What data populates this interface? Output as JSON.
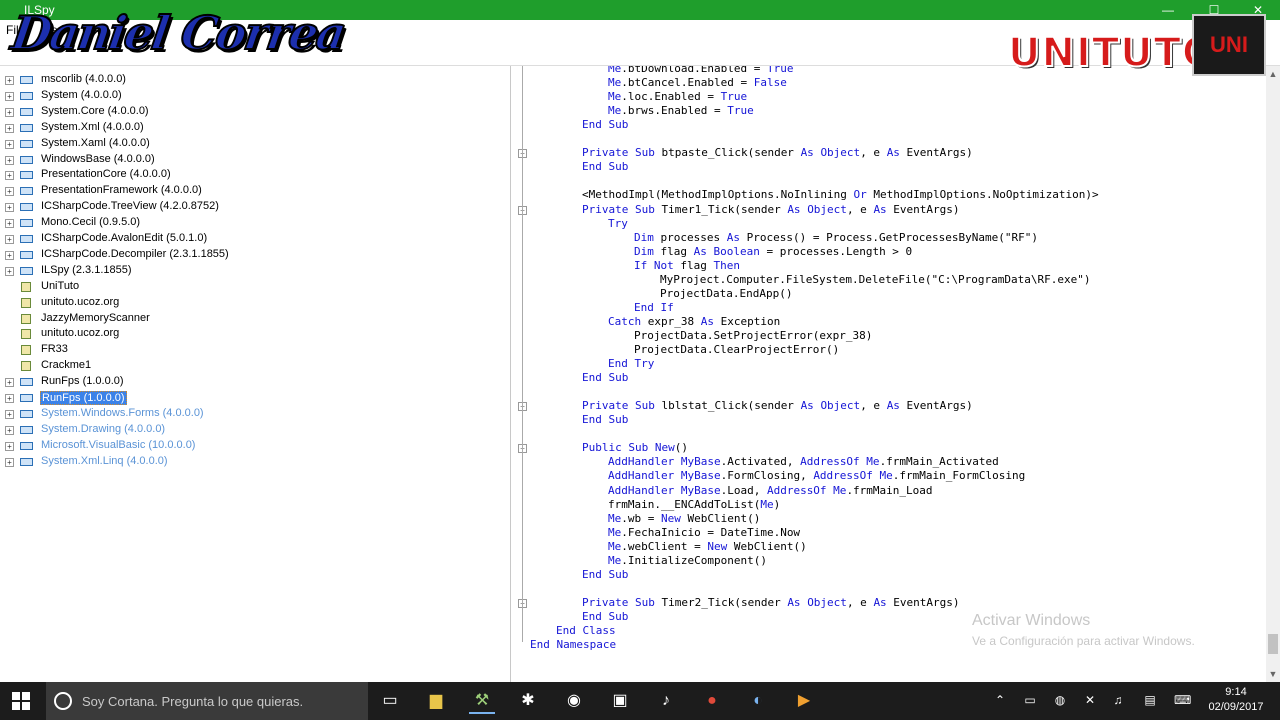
{
  "window": {
    "title": "ILSpy",
    "btn_min": "—",
    "btn_max": "☐",
    "btn_close": "✕"
  },
  "menu": {
    "file": "File",
    "view": "View",
    "help": "Help"
  },
  "overlays": {
    "left_logo": "Daniel Correa",
    "right_logo": "UNITUTO",
    "right_badge": "UNI"
  },
  "tree": {
    "items": [
      {
        "label": "mscorlib (4.0.0.0)",
        "state": "normal",
        "icon": "assembly"
      },
      {
        "label": "System (4.0.0.0)",
        "state": "normal",
        "icon": "assembly"
      },
      {
        "label": "System.Core (4.0.0.0)",
        "state": "normal",
        "icon": "assembly"
      },
      {
        "label": "System.Xml (4.0.0.0)",
        "state": "normal",
        "icon": "assembly"
      },
      {
        "label": "System.Xaml (4.0.0.0)",
        "state": "normal",
        "icon": "assembly"
      },
      {
        "label": "WindowsBase (4.0.0.0)",
        "state": "normal",
        "icon": "assembly"
      },
      {
        "label": "PresentationCore (4.0.0.0)",
        "state": "normal",
        "icon": "assembly"
      },
      {
        "label": "PresentationFramework (4.0.0.0)",
        "state": "normal",
        "icon": "assembly"
      },
      {
        "label": "ICSharpCode.TreeView (4.2.0.8752)",
        "state": "normal",
        "icon": "assembly"
      },
      {
        "label": "Mono.Cecil (0.9.5.0)",
        "state": "normal",
        "icon": "assembly"
      },
      {
        "label": "ICSharpCode.AvalonEdit (5.0.1.0)",
        "state": "normal",
        "icon": "assembly"
      },
      {
        "label": "ICSharpCode.Decompiler (2.3.1.1855)",
        "state": "normal",
        "icon": "assembly"
      },
      {
        "label": "ILSpy (2.3.1.1855)",
        "state": "normal",
        "icon": "assembly"
      },
      {
        "label": "UniTuto",
        "state": "normal",
        "icon": "resource"
      },
      {
        "label": "unituto.ucoz.org",
        "state": "normal",
        "icon": "resource"
      },
      {
        "label": "JazzyMemoryScanner",
        "state": "normal",
        "icon": "resource"
      },
      {
        "label": "unituto.ucoz.org",
        "state": "normal",
        "icon": "resource"
      },
      {
        "label": "FR33",
        "state": "normal",
        "icon": "resource"
      },
      {
        "label": "Crackme1",
        "state": "normal",
        "icon": "resource"
      },
      {
        "label": "RunFps (1.0.0.0)",
        "state": "normal",
        "icon": "assembly"
      },
      {
        "label": "RunFps (1.0.0.0)",
        "state": "selected",
        "icon": "assembly"
      },
      {
        "label": "System.Windows.Forms (4.0.0.0)",
        "state": "dim",
        "icon": "assembly"
      },
      {
        "label": "System.Drawing (4.0.0.0)",
        "state": "dim",
        "icon": "assembly"
      },
      {
        "label": "Microsoft.VisualBasic (10.0.0.0)",
        "state": "dim",
        "icon": "assembly"
      },
      {
        "label": "System.Xml.Linq (4.0.0.0)",
        "state": "dim",
        "icon": "assembly"
      }
    ]
  },
  "code": {
    "lines": [
      {
        "indent": 6,
        "fold": false,
        "tokens": [
          [
            "Me",
            "kw"
          ],
          [
            ".btDownload.Enabled = ",
            ""
          ],
          [
            "True",
            "kw"
          ]
        ]
      },
      {
        "indent": 6,
        "fold": false,
        "tokens": [
          [
            "Me",
            "kw"
          ],
          [
            ".btCancel.Enabled = ",
            ""
          ],
          [
            "False",
            "kw"
          ]
        ]
      },
      {
        "indent": 6,
        "fold": false,
        "tokens": [
          [
            "Me",
            "kw"
          ],
          [
            ".loc.Enabled = ",
            ""
          ],
          [
            "True",
            "kw"
          ]
        ]
      },
      {
        "indent": 6,
        "fold": false,
        "tokens": [
          [
            "Me",
            "kw"
          ],
          [
            ".brws.Enabled = ",
            ""
          ],
          [
            "True",
            "kw"
          ]
        ]
      },
      {
        "indent": 4,
        "fold": false,
        "tokens": [
          [
            "End Sub",
            "kw"
          ]
        ]
      },
      {
        "indent": 0,
        "fold": false,
        "tokens": []
      },
      {
        "indent": 4,
        "fold": true,
        "tokens": [
          [
            "Private Sub",
            "kw"
          ],
          [
            " btpaste_Click(sender ",
            ""
          ],
          [
            "As",
            "kw"
          ],
          [
            " ",
            ""
          ],
          [
            "Object",
            "kw"
          ],
          [
            ", e ",
            ""
          ],
          [
            "As",
            "kw"
          ],
          [
            " EventArgs)",
            ""
          ]
        ]
      },
      {
        "indent": 4,
        "fold": false,
        "tokens": [
          [
            "End Sub",
            "kw"
          ]
        ]
      },
      {
        "indent": 0,
        "fold": false,
        "tokens": []
      },
      {
        "indent": 4,
        "fold": false,
        "tokens": [
          [
            "<MethodImpl(MethodImplOptions.NoInlining ",
            ""
          ],
          [
            "Or",
            "kw"
          ],
          [
            " MethodImplOptions.NoOptimization)>",
            ""
          ]
        ]
      },
      {
        "indent": 4,
        "fold": true,
        "tokens": [
          [
            "Private Sub",
            "kw"
          ],
          [
            " Timer1_Tick(sender ",
            ""
          ],
          [
            "As",
            "kw"
          ],
          [
            " ",
            ""
          ],
          [
            "Object",
            "kw"
          ],
          [
            ", e ",
            ""
          ],
          [
            "As",
            "kw"
          ],
          [
            " EventArgs)",
            ""
          ]
        ]
      },
      {
        "indent": 6,
        "fold": false,
        "tokens": [
          [
            "Try",
            "kw"
          ]
        ]
      },
      {
        "indent": 8,
        "fold": false,
        "tokens": [
          [
            "Dim",
            "kw"
          ],
          [
            " processes ",
            ""
          ],
          [
            "As",
            "kw"
          ],
          [
            " Process() = Process.GetProcessesByName(\"RF\")",
            ""
          ]
        ]
      },
      {
        "indent": 8,
        "fold": false,
        "tokens": [
          [
            "Dim",
            "kw"
          ],
          [
            " flag ",
            ""
          ],
          [
            "As",
            "kw"
          ],
          [
            " ",
            ""
          ],
          [
            "Boolean",
            "kw"
          ],
          [
            " = processes.Length > 0",
            ""
          ]
        ]
      },
      {
        "indent": 8,
        "fold": false,
        "tokens": [
          [
            "If Not",
            "kw"
          ],
          [
            " flag ",
            ""
          ],
          [
            "Then",
            "kw"
          ]
        ]
      },
      {
        "indent": 10,
        "fold": false,
        "tokens": [
          [
            "MyProject.Computer.FileSystem.DeleteFile(\"C:\\ProgramData\\RF.exe\")",
            ""
          ]
        ]
      },
      {
        "indent": 10,
        "fold": false,
        "tokens": [
          [
            "ProjectData.EndApp()",
            ""
          ]
        ]
      },
      {
        "indent": 8,
        "fold": false,
        "tokens": [
          [
            "End If",
            "kw"
          ]
        ]
      },
      {
        "indent": 6,
        "fold": false,
        "tokens": [
          [
            "Catch",
            "kw"
          ],
          [
            " expr_38 ",
            ""
          ],
          [
            "As",
            "kw"
          ],
          [
            " Exception",
            ""
          ]
        ]
      },
      {
        "indent": 8,
        "fold": false,
        "tokens": [
          [
            "ProjectData.SetProjectError(expr_38)",
            ""
          ]
        ]
      },
      {
        "indent": 8,
        "fold": false,
        "tokens": [
          [
            "ProjectData.ClearProjectError()",
            ""
          ]
        ]
      },
      {
        "indent": 6,
        "fold": false,
        "tokens": [
          [
            "End Try",
            "kw"
          ]
        ]
      },
      {
        "indent": 4,
        "fold": false,
        "tokens": [
          [
            "End Sub",
            "kw"
          ]
        ]
      },
      {
        "indent": 0,
        "fold": false,
        "tokens": []
      },
      {
        "indent": 4,
        "fold": true,
        "tokens": [
          [
            "Private Sub",
            "kw"
          ],
          [
            " lblstat_Click(sender ",
            ""
          ],
          [
            "As",
            "kw"
          ],
          [
            " ",
            ""
          ],
          [
            "Object",
            "kw"
          ],
          [
            ", e ",
            ""
          ],
          [
            "As",
            "kw"
          ],
          [
            " EventArgs)",
            ""
          ]
        ]
      },
      {
        "indent": 4,
        "fold": false,
        "tokens": [
          [
            "End Sub",
            "kw"
          ]
        ]
      },
      {
        "indent": 0,
        "fold": false,
        "tokens": []
      },
      {
        "indent": 4,
        "fold": true,
        "tokens": [
          [
            "Public Sub New",
            "kw"
          ],
          [
            "()",
            ""
          ]
        ]
      },
      {
        "indent": 6,
        "fold": false,
        "tokens": [
          [
            "AddHandler MyBase",
            "kw"
          ],
          [
            ".Activated, ",
            ""
          ],
          [
            "AddressOf Me",
            "kw"
          ],
          [
            ".frmMain_Activated",
            ""
          ]
        ]
      },
      {
        "indent": 6,
        "fold": false,
        "tokens": [
          [
            "AddHandler MyBase",
            "kw"
          ],
          [
            ".FormClosing, ",
            ""
          ],
          [
            "AddressOf Me",
            "kw"
          ],
          [
            ".frmMain_FormClosing",
            ""
          ]
        ]
      },
      {
        "indent": 6,
        "fold": false,
        "tokens": [
          [
            "AddHandler MyBase",
            "kw"
          ],
          [
            ".Load, ",
            ""
          ],
          [
            "AddressOf Me",
            "kw"
          ],
          [
            ".frmMain_Load",
            ""
          ]
        ]
      },
      {
        "indent": 6,
        "fold": false,
        "tokens": [
          [
            "frmMain.__ENCAddToList(",
            ""
          ],
          [
            "Me",
            "kw"
          ],
          [
            ")",
            ""
          ]
        ]
      },
      {
        "indent": 6,
        "fold": false,
        "tokens": [
          [
            "Me",
            "kw"
          ],
          [
            ".wb = ",
            ""
          ],
          [
            "New",
            "kw"
          ],
          [
            " WebClient()",
            ""
          ]
        ]
      },
      {
        "indent": 6,
        "fold": false,
        "tokens": [
          [
            "Me",
            "kw"
          ],
          [
            ".FechaInicio = DateTime.Now",
            ""
          ]
        ]
      },
      {
        "indent": 6,
        "fold": false,
        "tokens": [
          [
            "Me",
            "kw"
          ],
          [
            ".webClient = ",
            ""
          ],
          [
            "New",
            "kw"
          ],
          [
            " WebClient()",
            ""
          ]
        ]
      },
      {
        "indent": 6,
        "fold": false,
        "tokens": [
          [
            "Me",
            "kw"
          ],
          [
            ".InitializeComponent()",
            ""
          ]
        ]
      },
      {
        "indent": 4,
        "fold": false,
        "tokens": [
          [
            "End Sub",
            "kw"
          ]
        ]
      },
      {
        "indent": 0,
        "fold": false,
        "tokens": []
      },
      {
        "indent": 4,
        "fold": true,
        "tokens": [
          [
            "Private Sub",
            "kw"
          ],
          [
            " Timer2_Tick(sender ",
            ""
          ],
          [
            "As",
            "kw"
          ],
          [
            " ",
            ""
          ],
          [
            "Object",
            "kw"
          ],
          [
            ", e ",
            ""
          ],
          [
            "As",
            "kw"
          ],
          [
            " EventArgs)",
            ""
          ]
        ]
      },
      {
        "indent": 4,
        "fold": false,
        "tokens": [
          [
            "End Sub",
            "kw"
          ]
        ]
      },
      {
        "indent": 2,
        "fold": false,
        "tokens": [
          [
            "End Class",
            "kw"
          ]
        ]
      },
      {
        "indent": 0,
        "fold": false,
        "tokens": [
          [
            "End Namespace",
            "kw"
          ]
        ]
      }
    ]
  },
  "watermark": {
    "line1": "Activar Windows",
    "line2": "Ve a Configuración para activar Windows."
  },
  "taskbar": {
    "search_placeholder": "Soy Cortana. Pregunta lo que quieras.",
    "time": "9:14",
    "date": "02/09/2017"
  },
  "colors": {
    "titlebar": "#1f9e2c",
    "keyword": "#1515d6",
    "selection": "#3b82e8",
    "dim_item": "#5a93d6",
    "taskbar": "#1c1c1c"
  }
}
